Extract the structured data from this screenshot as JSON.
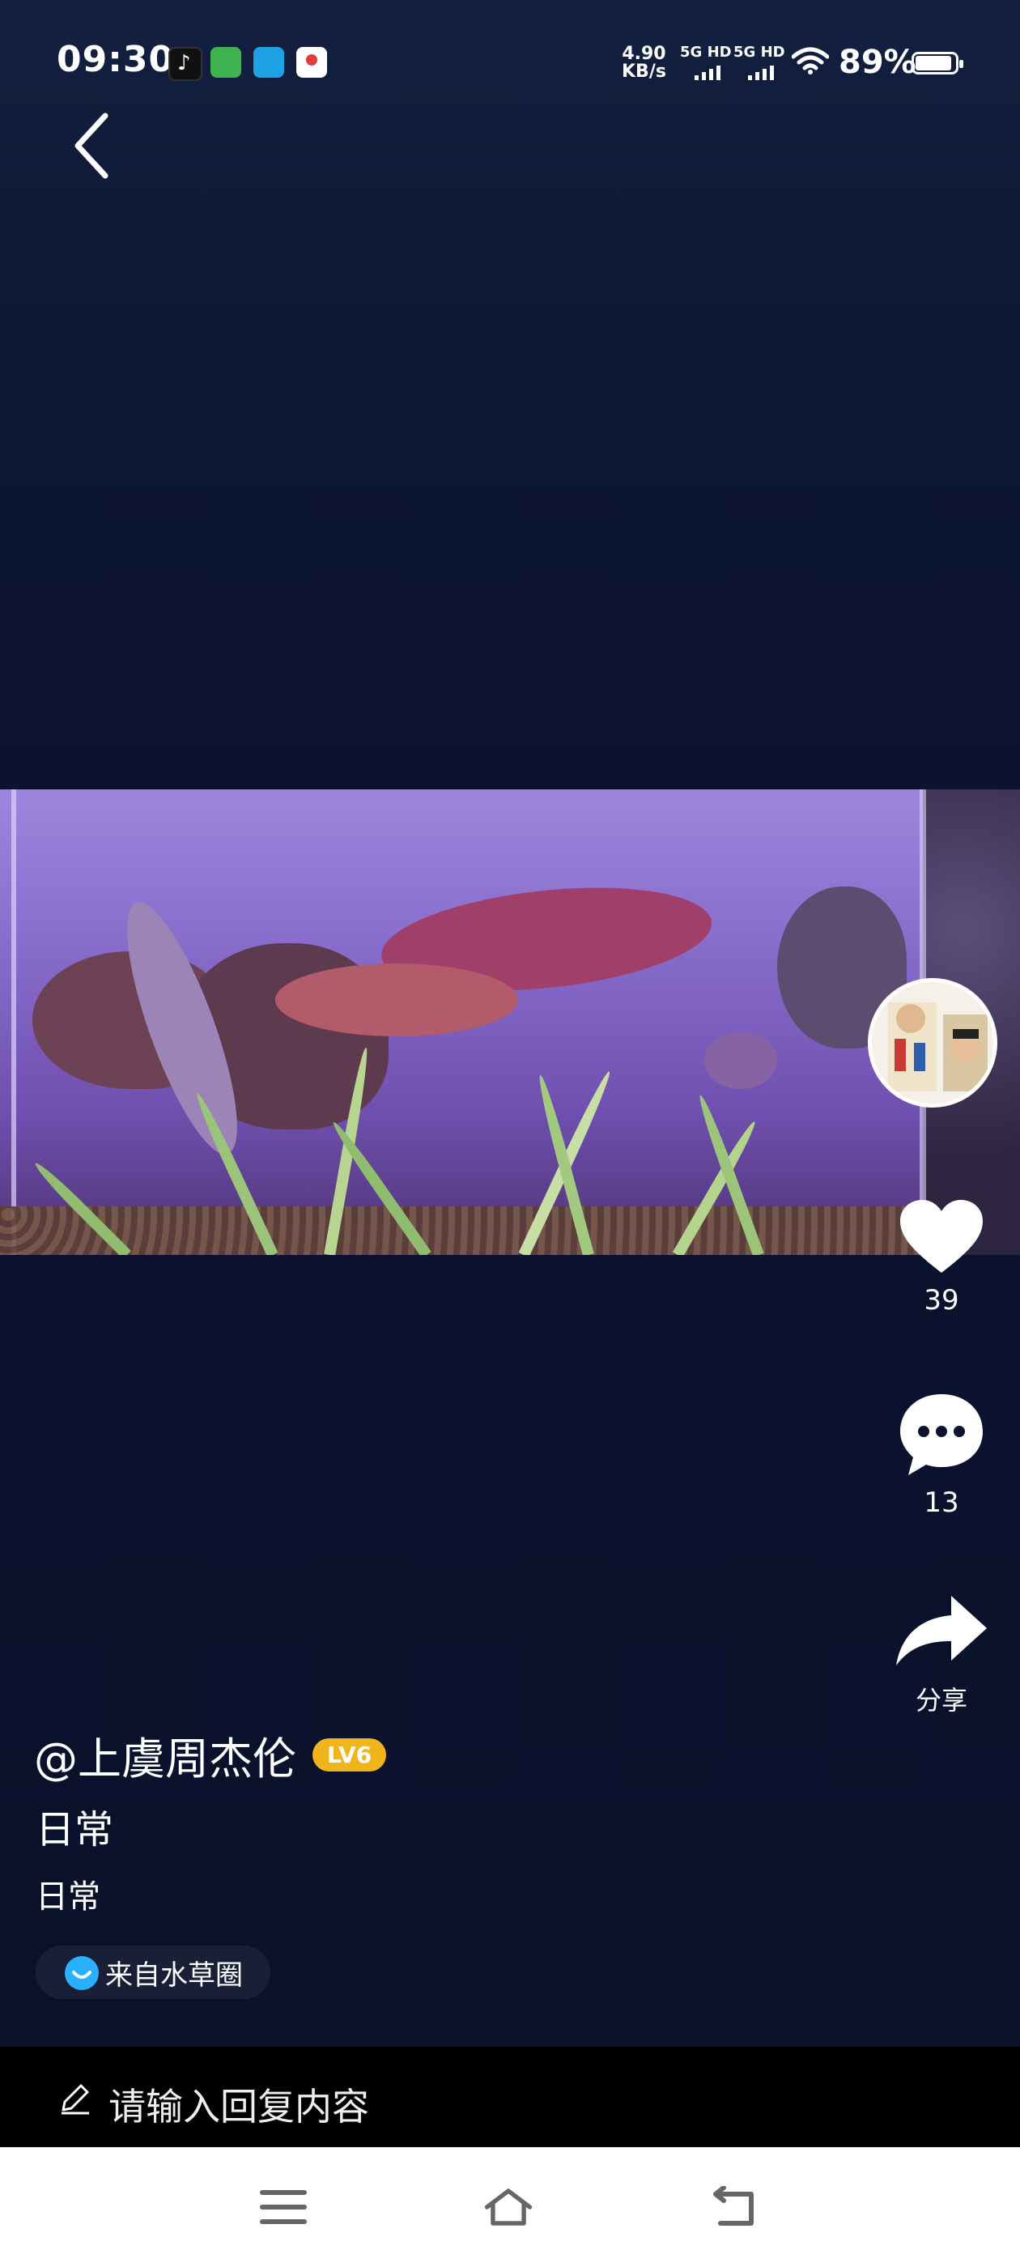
{
  "status_bar": {
    "time": "09:30",
    "net_speed_value": "4.90",
    "net_speed_unit": "KB/s",
    "sim1_label": "5G HD",
    "sim2_label": "5G HD",
    "battery_pct": "89%",
    "notif_icons": [
      "douyin-icon",
      "wechat-pay-icon",
      "ele-icon",
      "map-pin-icon"
    ]
  },
  "post": {
    "author": "@上虞周杰伦",
    "level": "LV6",
    "title": "日常",
    "description": "日常",
    "source": "来自水草圈"
  },
  "actions": {
    "likes": "39",
    "comments": "13",
    "share_label": "分享"
  },
  "reply": {
    "placeholder": "请输入回复内容"
  },
  "colors": {
    "background": "#0b1230",
    "level_badge": "#f1b51c",
    "source_icon": "#2ab0ff"
  }
}
